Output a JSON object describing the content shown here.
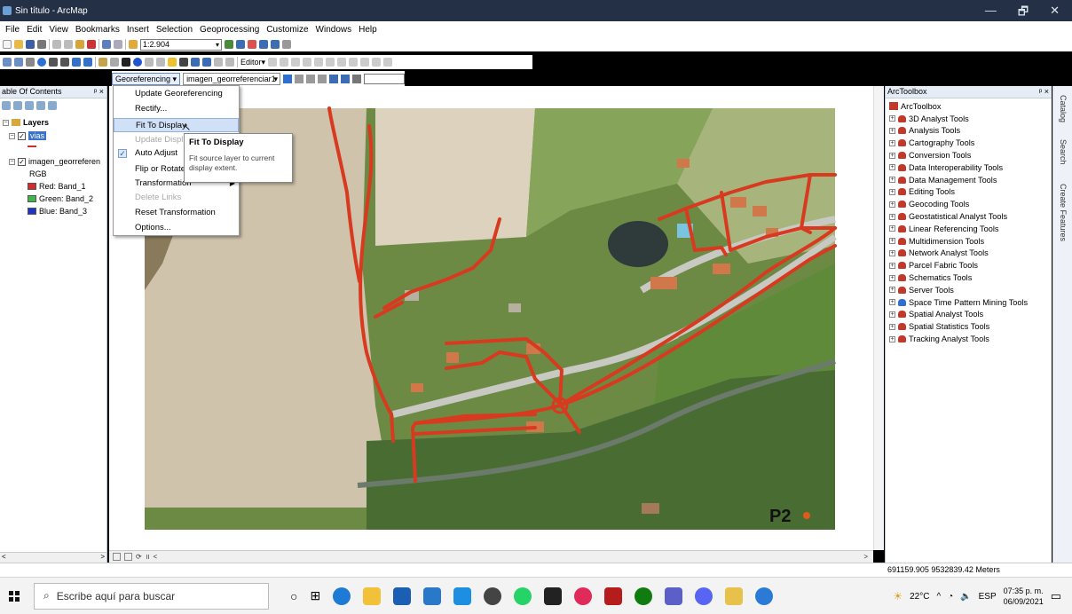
{
  "window": {
    "title": "Sin título - ArcMap",
    "minimize": "—",
    "maximize": "🗗",
    "close": "✕"
  },
  "menu": [
    "File",
    "Edit",
    "View",
    "Bookmarks",
    "Insert",
    "Selection",
    "Geoprocessing",
    "Customize",
    "Windows",
    "Help"
  ],
  "toolbar": {
    "scale": "1:2.904",
    "editor_label": "Editor▾"
  },
  "georef_toolbar": {
    "button_label": "Georeferencing ▾",
    "layer_value": "imagen_georreferenciar1"
  },
  "georef_menu": {
    "items": [
      {
        "label": "Update Georeferencing"
      },
      {
        "label": "Rectify..."
      },
      {
        "label": "Fit To Display"
      },
      {
        "label": "Update Displ"
      },
      {
        "label": "Auto Adjust"
      },
      {
        "label": "Flip or Rotate"
      },
      {
        "label": "Transformation"
      },
      {
        "label": "Delete Links"
      },
      {
        "label": "Reset Transformation"
      },
      {
        "label": "Options..."
      }
    ],
    "tooltip_title": "Fit To Display",
    "tooltip_body": "Fit source layer to current display extent."
  },
  "toc": {
    "title": "able Of Contents",
    "pin": "ᵖ ×",
    "layers_label": "Layers",
    "vias_label": "vias",
    "raster_label": "imagen_georreferen",
    "rgb_label": "RGB",
    "bands": [
      {
        "label": "Red:  Band_1",
        "color": "#d62b2b"
      },
      {
        "label": "Green: Band_2",
        "color": "#3fb54a"
      },
      {
        "label": "Blue:  Band_3",
        "color": "#1f33c8"
      }
    ]
  },
  "toolbox": {
    "title": "ArcToolbox",
    "pin": "ᵖ ×",
    "root": "ArcToolbox",
    "items": [
      "3D Analyst Tools",
      "Analysis Tools",
      "Cartography Tools",
      "Conversion Tools",
      "Data Interoperability Tools",
      "Data Management Tools",
      "Editing Tools",
      "Geocoding Tools",
      "Geostatistical Analyst Tools",
      "Linear Referencing Tools",
      "Multidimension Tools",
      "Network Analyst Tools",
      "Parcel Fabric Tools",
      "Schematics Tools",
      "Server Tools",
      "Space Time Pattern Mining Tools",
      "Spatial Analyst Tools",
      "Spatial Statistics Tools",
      "Tracking Analyst Tools"
    ]
  },
  "side_tabs": [
    "Catalog",
    "Search",
    "Create Features"
  ],
  "map": {
    "label": "P2"
  },
  "status": {
    "coords": "691159.905  9532839.42 Meters"
  },
  "taskbar": {
    "search_placeholder": "Escribe aquí para buscar",
    "temperature": "22°C",
    "lang": "ESP",
    "time": "07:35 p. m.",
    "date": "06/09/2021"
  },
  "colors": {
    "road": "#d83a20",
    "title_bar": "#233045",
    "menu_highlight": "#cfe0f7"
  }
}
